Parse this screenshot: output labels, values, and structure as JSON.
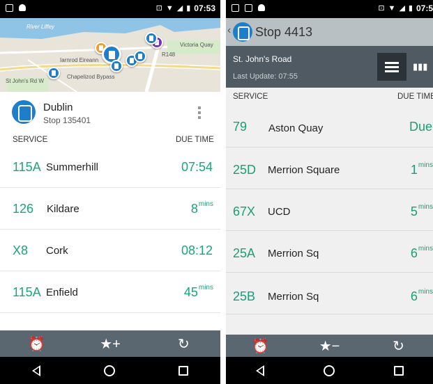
{
  "left": {
    "status": {
      "time": "07:53"
    },
    "map": {
      "labels": [
        "River Liffey",
        "Iarnrod Eireann",
        "Victoria Quay",
        "R148",
        "Chapelizod Bypass",
        "St John's Rd W"
      ]
    },
    "stop": {
      "name": "Dublin",
      "code": "Stop 135401"
    },
    "columns": {
      "service": "SERVICE",
      "due": "DUE TIME"
    },
    "rows": [
      {
        "route": "115A",
        "dest": "Summerhill",
        "due": "07:54",
        "unit": ""
      },
      {
        "route": "126",
        "dest": "Kildare",
        "due": "8",
        "unit": "mins"
      },
      {
        "route": "X8",
        "dest": "Cork",
        "due": "08:12",
        "unit": ""
      },
      {
        "route": "115A",
        "dest": "Enfield",
        "due": "45",
        "unit": "mins"
      }
    ],
    "toolbar": {
      "alarm_icon": "⏰",
      "fav_icon": "★+",
      "refresh_icon": "↻"
    }
  },
  "right": {
    "status": {
      "time": "07:5"
    },
    "title": "Stop  4413",
    "road": "St. John's Road",
    "last_update": "Last Update: 07:55",
    "columns": {
      "service": "SERVICE",
      "due": "DUE TIME"
    },
    "rows": [
      {
        "route": "79",
        "dest": "Aston Quay",
        "due": "Due",
        "unit": ""
      },
      {
        "route": "25D",
        "dest": "Merrion Square",
        "due": "1",
        "unit": "mins"
      },
      {
        "route": "67X",
        "dest": "UCD",
        "due": "5",
        "unit": "mins"
      },
      {
        "route": "25A",
        "dest": "Merrion Sq",
        "due": "6",
        "unit": "mins"
      },
      {
        "route": "25B",
        "dest": "Merrion Sq",
        "due": "6",
        "unit": "mins"
      }
    ],
    "toolbar": {
      "alarm_icon": "⏰",
      "fav_icon": "★−",
      "refresh_icon": "↻"
    }
  },
  "colors": {
    "accent": "#1aa679",
    "brand_blue": "#1f7ec9",
    "toolbar": "#5a6670",
    "header_dark": "#4f5a62"
  }
}
